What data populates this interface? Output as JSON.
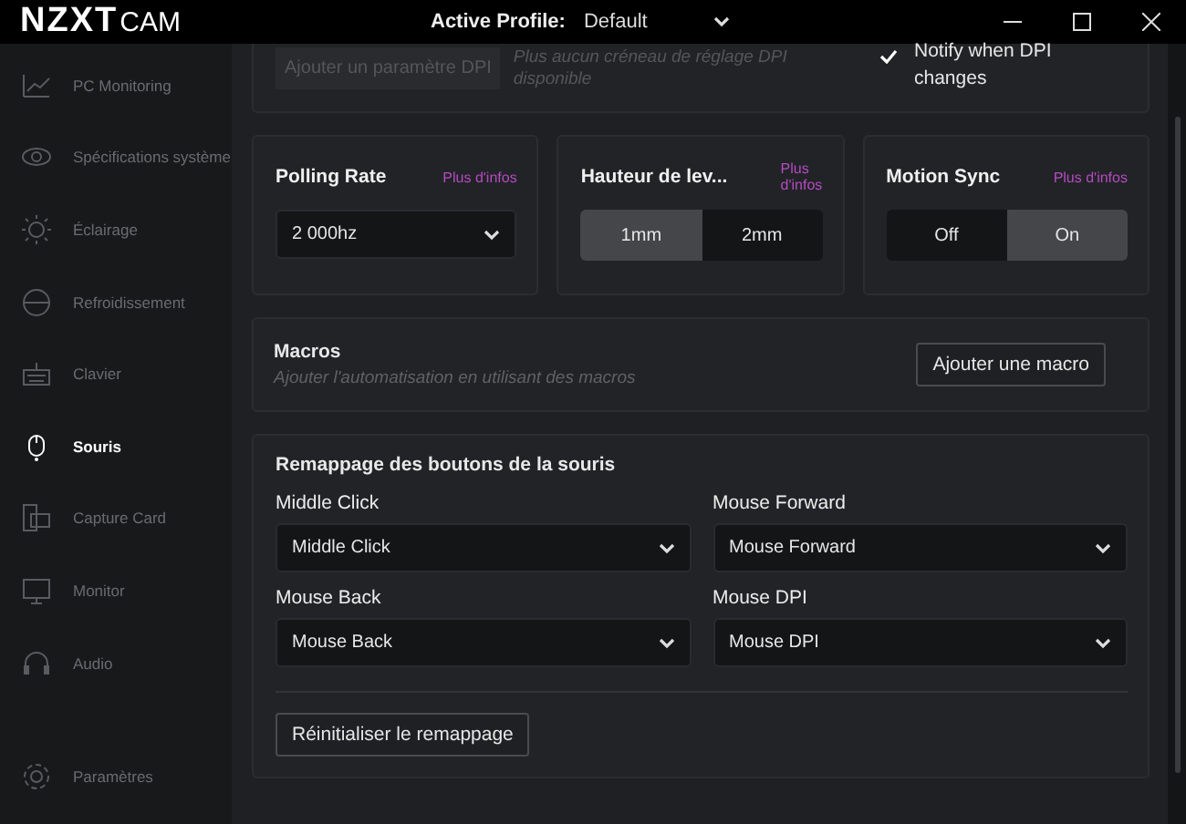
{
  "window": {
    "logo_bold": "NZXT",
    "logo_light": "CAM",
    "profile_label": "Active Profile:",
    "profile_value": "Default"
  },
  "sidebar": {
    "items": [
      {
        "label": "PC Monitoring",
        "selected": false
      },
      {
        "label": "Spécifications système",
        "selected": false
      },
      {
        "label": "Éclairage",
        "selected": false
      },
      {
        "label": "Refroidissement",
        "selected": false
      },
      {
        "label": "Clavier",
        "selected": false
      },
      {
        "label": "Souris",
        "selected": true
      },
      {
        "label": "Capture Card",
        "selected": false
      },
      {
        "label": "Monitor",
        "selected": false
      },
      {
        "label": "Audio",
        "selected": false
      }
    ],
    "footer": {
      "label": "Paramètres",
      "selected": false
    }
  },
  "dpi": {
    "add_button": {
      "label": "Ajouter un paramètre DPI",
      "disabled": true
    },
    "hint": "Plus aucun créneau de réglage DPI disponible",
    "notify": {
      "label": "Notify when DPI changes",
      "checked": true
    }
  },
  "settings": [
    {
      "title": "Polling Rate",
      "info": "Plus d'infos",
      "kind": "dropdown",
      "value": "2 000hz"
    },
    {
      "title": "Hauteur de lev...",
      "info": "Plus d'infos",
      "kind": "segmented",
      "options": [
        {
          "label": "1mm",
          "selected": true
        },
        {
          "label": "2mm",
          "selected": false
        }
      ]
    },
    {
      "title": "Motion Sync",
      "info": "Plus d'infos",
      "kind": "segmented",
      "options": [
        {
          "label": "Off",
          "selected": false
        },
        {
          "label": "On",
          "selected": true
        }
      ]
    }
  ],
  "macros": {
    "title": "Macros",
    "description": "Ajouter l'automatisation en utilisant des macros",
    "button": "Ajouter une macro"
  },
  "remap": {
    "title": "Remappage des boutons de la souris",
    "fields": [
      {
        "label": "Middle Click",
        "value": "Middle Click"
      },
      {
        "label": "Mouse Forward",
        "value": "Mouse Forward"
      },
      {
        "label": "Mouse Back",
        "value": "Mouse Back"
      },
      {
        "label": "Mouse DPI",
        "value": "Mouse DPI"
      }
    ],
    "reset_button": "Réinitialiser le remappage"
  }
}
